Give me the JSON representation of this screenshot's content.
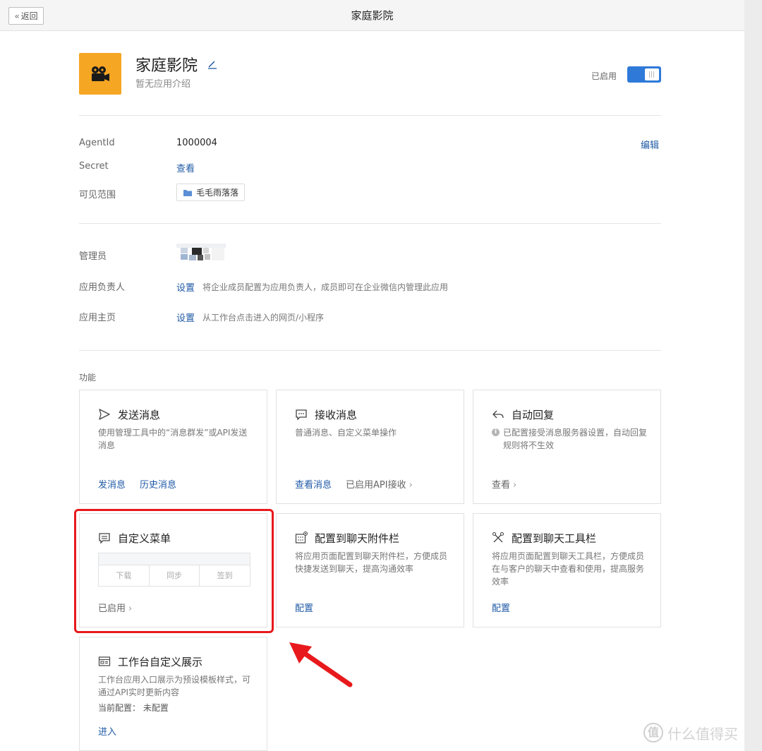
{
  "topbar": {
    "back_label": "返回",
    "title": "家庭影院"
  },
  "app": {
    "name": "家庭影院",
    "description": "暂无应用介绍",
    "status_label": "已启用",
    "enabled": true,
    "icon_color": "#f5a623"
  },
  "details": {
    "agentid_label": "AgentId",
    "agentid_value": "1000004",
    "edit_label": "编辑",
    "secret_label": "Secret",
    "secret_view": "查看",
    "scope_label": "可见范围",
    "scope_value": "毛毛雨落落"
  },
  "admin": {
    "admin_label": "管理员",
    "owner_label": "应用负责人",
    "owner_action": "设置",
    "owner_hint": "将企业成员配置为应用负责人，成员即可在企业微信内管理此应用",
    "homepage_label": "应用主页",
    "homepage_action": "设置",
    "homepage_hint": "从工作台点击进入的网页/小程序"
  },
  "features": {
    "section_title": "功能",
    "send": {
      "title": "发送消息",
      "desc": "使用管理工具中的“消息群发”或API发送消息",
      "action1": "发消息",
      "action2": "历史消息"
    },
    "receive": {
      "title": "接收消息",
      "desc": "普通消息、自定义菜单操作",
      "action1": "查看消息",
      "action2": "已启用API接收"
    },
    "autoreply": {
      "title": "自动回复",
      "desc": "已配置接受消息服务器设置，自动回复规则将不生效",
      "action1": "查看"
    },
    "custom_menu": {
      "title": "自定义菜单",
      "menu_items": [
        "下载",
        "同步",
        "签到"
      ],
      "status": "已启用"
    },
    "chat_attach": {
      "title": "配置到聊天附件栏",
      "desc": "将应用页面配置到聊天附件栏，方便成员快捷发送到聊天，提高沟通效率",
      "action1": "配置"
    },
    "chat_toolbar": {
      "title": "配置到聊天工具栏",
      "desc": "将应用页面配置到聊天工具栏，方便成员在与客户的聊天中查看和使用，提高服务效率",
      "action1": "配置"
    },
    "workbench": {
      "title": "工作台自定义展示",
      "desc": "工作台应用入口展示为预设模板样式，可通过API实时更新内容",
      "config_line": "当前配置：  未配置",
      "action1": "进入"
    }
  },
  "watermark": {
    "glyph": "值",
    "text": "什么值得买"
  },
  "colors": {
    "accent": "#2f7ad8",
    "link": "#1f5aa6",
    "highlight": "#e8191c"
  }
}
